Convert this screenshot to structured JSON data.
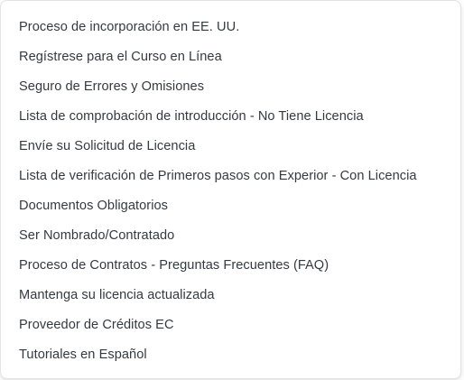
{
  "menu": {
    "items": [
      {
        "label": "Proceso de incorporación en EE. UU."
      },
      {
        "label": "Regístrese para el Curso en Línea"
      },
      {
        "label": "Seguro de Errores y Omisiones"
      },
      {
        "label": "Lista de comprobación de introducción - No Tiene Licencia"
      },
      {
        "label": "Envíe su Solicitud de Licencia"
      },
      {
        "label": "Lista de verificación de Primeros pasos con Experior - Con Licencia"
      },
      {
        "label": "Documentos Obligatorios"
      },
      {
        "label": "Ser Nombrado/Contratado"
      },
      {
        "label": "Proceso de Contratos - Preguntas Frecuentes (FAQ)"
      },
      {
        "label": "Mantenga su licencia actualizada"
      },
      {
        "label": "Proveedor de Créditos EC"
      },
      {
        "label": "Tutoriales en Español"
      }
    ]
  }
}
